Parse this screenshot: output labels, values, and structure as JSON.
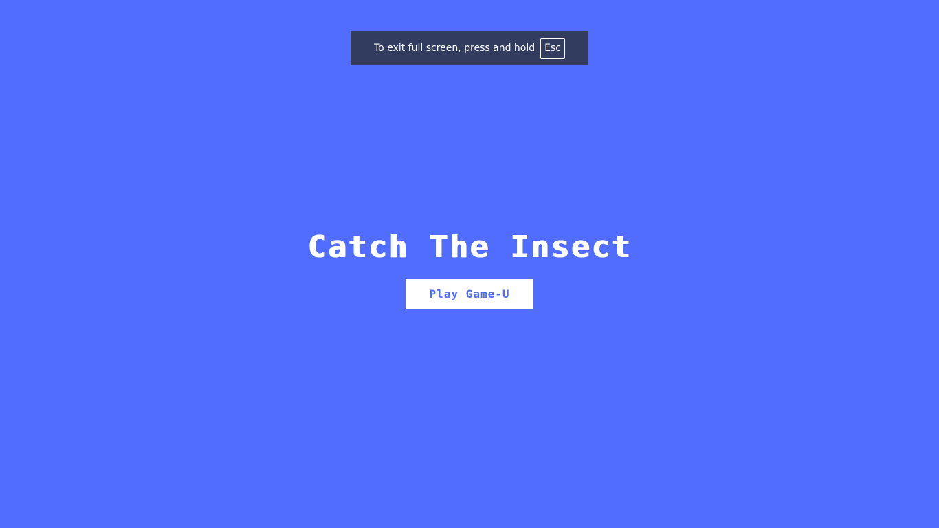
{
  "fullscreen_notice": {
    "message": "To exit full screen, press and hold",
    "key": "Esc"
  },
  "game": {
    "title": "Catch The Insect",
    "play_button_label": "Play Game-U"
  },
  "colors": {
    "background": "#516dff",
    "notice_background": "#323c5e",
    "button_background": "#ffffff",
    "button_text": "#516dff"
  }
}
